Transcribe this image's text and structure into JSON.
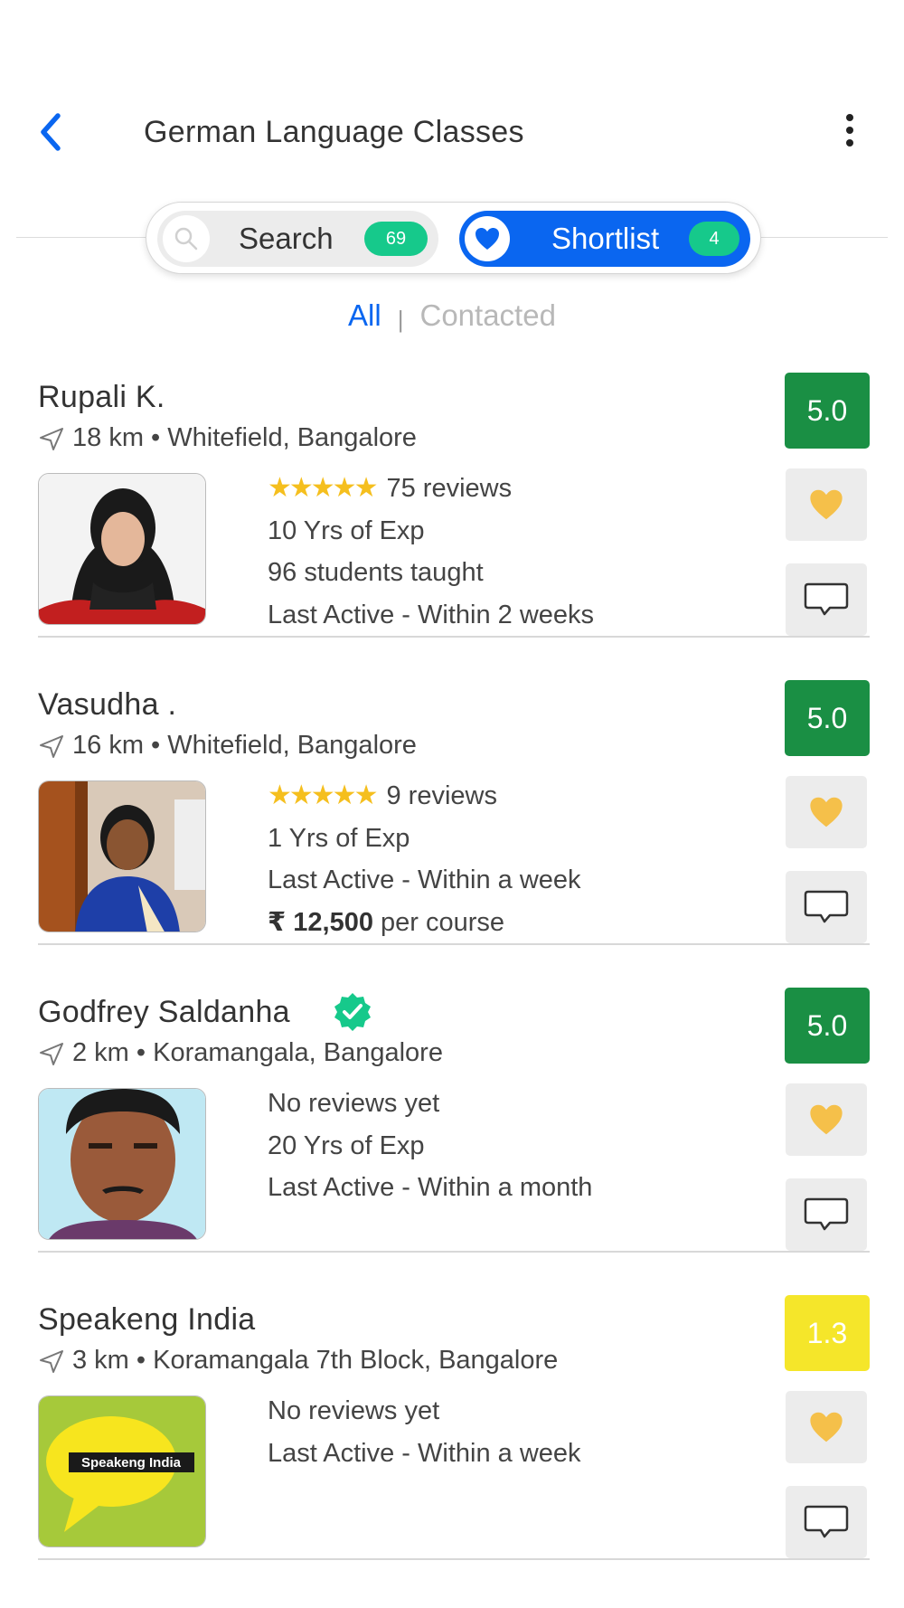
{
  "header": {
    "title": "German Language Classes"
  },
  "tabs": {
    "search": {
      "label": "Search",
      "count": "69"
    },
    "shortlist": {
      "label": "Shortlist",
      "count": "4"
    }
  },
  "filter": {
    "all": "All",
    "separator": "|",
    "contacted": "Contacted"
  },
  "colors": {
    "accent": "#0a66f0",
    "badge": "#16c98b",
    "rating_high": "#1a8f44",
    "rating_low": "#f5e62a",
    "heart": "#f5c04a",
    "star": "#f5bf1e"
  },
  "tutors": [
    {
      "name": "Rupali K.",
      "distance": "18 km",
      "location": "Whitefield, Bangalore",
      "rating": "5.0",
      "rating_level": "high",
      "stars": 5,
      "reviews": "75 reviews",
      "experience": "10 Yrs of Exp",
      "students": "96 students taught",
      "last_active": "Last Active - Within 2 weeks"
    },
    {
      "name": "Vasudha .",
      "distance": "16 km",
      "location": "Whitefield, Bangalore",
      "rating": "5.0",
      "rating_level": "high",
      "stars": 5,
      "reviews": "9 reviews",
      "experience": "1 Yrs of Exp",
      "last_active": "Last Active - Within a week",
      "currency": "₹",
      "price": "12,500",
      "price_unit": "per course"
    },
    {
      "name": "Godfrey Saldanha",
      "verified": true,
      "distance": "2 km",
      "location": "Koramangala, Bangalore",
      "rating": "5.0",
      "rating_level": "high",
      "reviews_text": "No reviews yet",
      "experience": "20 Yrs of Exp",
      "last_active": "Last Active - Within a month"
    },
    {
      "name": "Speakeng India",
      "distance": "3 km",
      "location": "Koramangala 7th Block, Bangalore",
      "rating": "1.3",
      "rating_level": "low",
      "reviews_text": "No reviews yet",
      "last_active": "Last Active - Within a week",
      "logo_text": "Speakeng India"
    }
  ]
}
